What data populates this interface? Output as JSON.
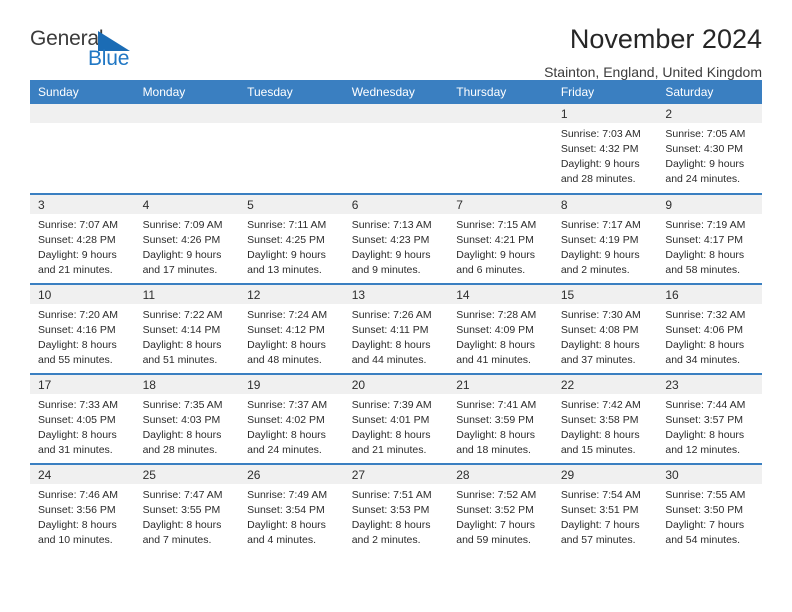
{
  "logo": {
    "word_one": "General",
    "word_two": "Blue",
    "triangle": "blue-triangle"
  },
  "header": {
    "title": "November 2024",
    "location": "Stainton, England, United Kingdom"
  },
  "colors": {
    "header_blue": "#3a7fc1",
    "logo_blue": "#2077c4",
    "daynum_gray": "#f0f0f0"
  },
  "calendar": {
    "weekday_headers": [
      "Sunday",
      "Monday",
      "Tuesday",
      "Wednesday",
      "Thursday",
      "Friday",
      "Saturday"
    ],
    "weeks": [
      [
        {
          "day": "",
          "sunrise": "",
          "sunset": "",
          "daylight_a": "",
          "daylight_b": ""
        },
        {
          "day": "",
          "sunrise": "",
          "sunset": "",
          "daylight_a": "",
          "daylight_b": ""
        },
        {
          "day": "",
          "sunrise": "",
          "sunset": "",
          "daylight_a": "",
          "daylight_b": ""
        },
        {
          "day": "",
          "sunrise": "",
          "sunset": "",
          "daylight_a": "",
          "daylight_b": ""
        },
        {
          "day": "",
          "sunrise": "",
          "sunset": "",
          "daylight_a": "",
          "daylight_b": ""
        },
        {
          "day": "1",
          "sunrise": "Sunrise: 7:03 AM",
          "sunset": "Sunset: 4:32 PM",
          "daylight_a": "Daylight: 9 hours",
          "daylight_b": "and 28 minutes."
        },
        {
          "day": "2",
          "sunrise": "Sunrise: 7:05 AM",
          "sunset": "Sunset: 4:30 PM",
          "daylight_a": "Daylight: 9 hours",
          "daylight_b": "and 24 minutes."
        }
      ],
      [
        {
          "day": "3",
          "sunrise": "Sunrise: 7:07 AM",
          "sunset": "Sunset: 4:28 PM",
          "daylight_a": "Daylight: 9 hours",
          "daylight_b": "and 21 minutes."
        },
        {
          "day": "4",
          "sunrise": "Sunrise: 7:09 AM",
          "sunset": "Sunset: 4:26 PM",
          "daylight_a": "Daylight: 9 hours",
          "daylight_b": "and 17 minutes."
        },
        {
          "day": "5",
          "sunrise": "Sunrise: 7:11 AM",
          "sunset": "Sunset: 4:25 PM",
          "daylight_a": "Daylight: 9 hours",
          "daylight_b": "and 13 minutes."
        },
        {
          "day": "6",
          "sunrise": "Sunrise: 7:13 AM",
          "sunset": "Sunset: 4:23 PM",
          "daylight_a": "Daylight: 9 hours",
          "daylight_b": "and 9 minutes."
        },
        {
          "day": "7",
          "sunrise": "Sunrise: 7:15 AM",
          "sunset": "Sunset: 4:21 PM",
          "daylight_a": "Daylight: 9 hours",
          "daylight_b": "and 6 minutes."
        },
        {
          "day": "8",
          "sunrise": "Sunrise: 7:17 AM",
          "sunset": "Sunset: 4:19 PM",
          "daylight_a": "Daylight: 9 hours",
          "daylight_b": "and 2 minutes."
        },
        {
          "day": "9",
          "sunrise": "Sunrise: 7:19 AM",
          "sunset": "Sunset: 4:17 PM",
          "daylight_a": "Daylight: 8 hours",
          "daylight_b": "and 58 minutes."
        }
      ],
      [
        {
          "day": "10",
          "sunrise": "Sunrise: 7:20 AM",
          "sunset": "Sunset: 4:16 PM",
          "daylight_a": "Daylight: 8 hours",
          "daylight_b": "and 55 minutes."
        },
        {
          "day": "11",
          "sunrise": "Sunrise: 7:22 AM",
          "sunset": "Sunset: 4:14 PM",
          "daylight_a": "Daylight: 8 hours",
          "daylight_b": "and 51 minutes."
        },
        {
          "day": "12",
          "sunrise": "Sunrise: 7:24 AM",
          "sunset": "Sunset: 4:12 PM",
          "daylight_a": "Daylight: 8 hours",
          "daylight_b": "and 48 minutes."
        },
        {
          "day": "13",
          "sunrise": "Sunrise: 7:26 AM",
          "sunset": "Sunset: 4:11 PM",
          "daylight_a": "Daylight: 8 hours",
          "daylight_b": "and 44 minutes."
        },
        {
          "day": "14",
          "sunrise": "Sunrise: 7:28 AM",
          "sunset": "Sunset: 4:09 PM",
          "daylight_a": "Daylight: 8 hours",
          "daylight_b": "and 41 minutes."
        },
        {
          "day": "15",
          "sunrise": "Sunrise: 7:30 AM",
          "sunset": "Sunset: 4:08 PM",
          "daylight_a": "Daylight: 8 hours",
          "daylight_b": "and 37 minutes."
        },
        {
          "day": "16",
          "sunrise": "Sunrise: 7:32 AM",
          "sunset": "Sunset: 4:06 PM",
          "daylight_a": "Daylight: 8 hours",
          "daylight_b": "and 34 minutes."
        }
      ],
      [
        {
          "day": "17",
          "sunrise": "Sunrise: 7:33 AM",
          "sunset": "Sunset: 4:05 PM",
          "daylight_a": "Daylight: 8 hours",
          "daylight_b": "and 31 minutes."
        },
        {
          "day": "18",
          "sunrise": "Sunrise: 7:35 AM",
          "sunset": "Sunset: 4:03 PM",
          "daylight_a": "Daylight: 8 hours",
          "daylight_b": "and 28 minutes."
        },
        {
          "day": "19",
          "sunrise": "Sunrise: 7:37 AM",
          "sunset": "Sunset: 4:02 PM",
          "daylight_a": "Daylight: 8 hours",
          "daylight_b": "and 24 minutes."
        },
        {
          "day": "20",
          "sunrise": "Sunrise: 7:39 AM",
          "sunset": "Sunset: 4:01 PM",
          "daylight_a": "Daylight: 8 hours",
          "daylight_b": "and 21 minutes."
        },
        {
          "day": "21",
          "sunrise": "Sunrise: 7:41 AM",
          "sunset": "Sunset: 3:59 PM",
          "daylight_a": "Daylight: 8 hours",
          "daylight_b": "and 18 minutes."
        },
        {
          "day": "22",
          "sunrise": "Sunrise: 7:42 AM",
          "sunset": "Sunset: 3:58 PM",
          "daylight_a": "Daylight: 8 hours",
          "daylight_b": "and 15 minutes."
        },
        {
          "day": "23",
          "sunrise": "Sunrise: 7:44 AM",
          "sunset": "Sunset: 3:57 PM",
          "daylight_a": "Daylight: 8 hours",
          "daylight_b": "and 12 minutes."
        }
      ],
      [
        {
          "day": "24",
          "sunrise": "Sunrise: 7:46 AM",
          "sunset": "Sunset: 3:56 PM",
          "daylight_a": "Daylight: 8 hours",
          "daylight_b": "and 10 minutes."
        },
        {
          "day": "25",
          "sunrise": "Sunrise: 7:47 AM",
          "sunset": "Sunset: 3:55 PM",
          "daylight_a": "Daylight: 8 hours",
          "daylight_b": "and 7 minutes."
        },
        {
          "day": "26",
          "sunrise": "Sunrise: 7:49 AM",
          "sunset": "Sunset: 3:54 PM",
          "daylight_a": "Daylight: 8 hours",
          "daylight_b": "and 4 minutes."
        },
        {
          "day": "27",
          "sunrise": "Sunrise: 7:51 AM",
          "sunset": "Sunset: 3:53 PM",
          "daylight_a": "Daylight: 8 hours",
          "daylight_b": "and 2 minutes."
        },
        {
          "day": "28",
          "sunrise": "Sunrise: 7:52 AM",
          "sunset": "Sunset: 3:52 PM",
          "daylight_a": "Daylight: 7 hours",
          "daylight_b": "and 59 minutes."
        },
        {
          "day": "29",
          "sunrise": "Sunrise: 7:54 AM",
          "sunset": "Sunset: 3:51 PM",
          "daylight_a": "Daylight: 7 hours",
          "daylight_b": "and 57 minutes."
        },
        {
          "day": "30",
          "sunrise": "Sunrise: 7:55 AM",
          "sunset": "Sunset: 3:50 PM",
          "daylight_a": "Daylight: 7 hours",
          "daylight_b": "and 54 minutes."
        }
      ]
    ]
  }
}
